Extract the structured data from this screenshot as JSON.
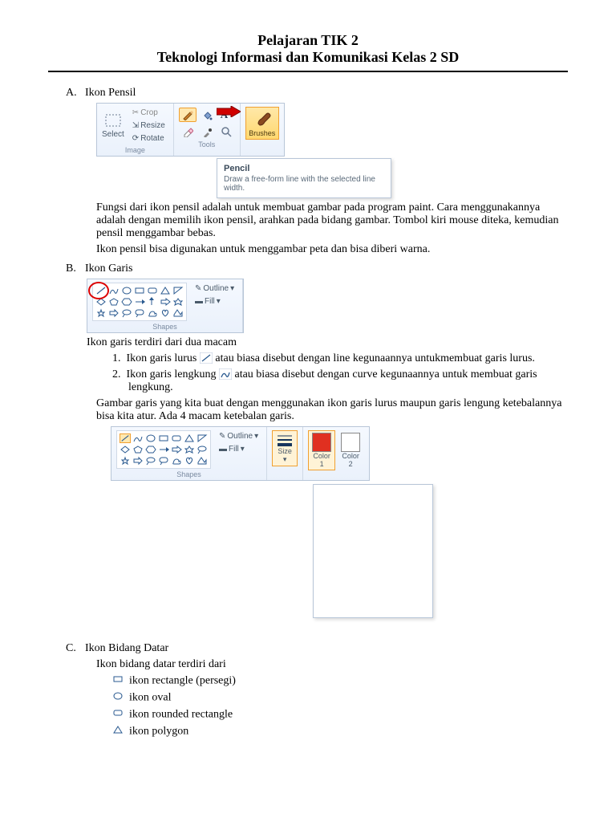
{
  "title": "Pelajaran TIK 2",
  "subtitle": "Teknologi Informasi dan Komunikasi Kelas 2 SD",
  "sections": {
    "A": {
      "letter": "A.",
      "heading": "Ikon Pensil",
      "ribbon": {
        "select": "Select",
        "crop": "Crop",
        "resize": "Resize",
        "rotate": "Rotate",
        "image_group": "Image",
        "tools_group": "Tools",
        "brushes": "Brushes"
      },
      "tooltip_title": "Pencil",
      "tooltip_body": "Draw a free-form line with the selected line width.",
      "para1": "Fungsi dari ikon pensil adalah untuk membuat gambar pada program paint. Cara menggunakannya adalah dengan memilih ikon pensil, arahkan pada bidang gambar. Tombol kiri mouse diteka, kemudian pensil menggambar bebas.",
      "para2": "Ikon pensil bisa digunakan untuk menggambar peta dan bisa diberi warna."
    },
    "B": {
      "letter": "B.",
      "heading": "Ikon Garis",
      "shapes_group": "Shapes",
      "outline": "Outline",
      "fill": "Fill",
      "intro": "Ikon garis terdiri dari dua macam",
      "item1_a": "Ikon garis lurus ",
      "item1_b": " atau biasa disebut dengan line kegunaannya untukmembuat garis lurus.",
      "item2_a": "Ikon garis lengkung ",
      "item2_b": " atau biasa disebut dengan curve kegunaannya untuk membuat garis lengkung.",
      "para": "Gambar garis yang kita buat dengan menggunakan ikon garis lurus maupun garis lengung ketebalannya bisa kita atur. Ada 4 macam ketebalan garis.",
      "size": "Size",
      "color1": "Color\n1",
      "color2": "Color\n2"
    },
    "C": {
      "letter": "C.",
      "heading": "Ikon Bidang Datar",
      "intro": "Ikon bidang datar terdiri dari",
      "items": {
        "rect": "ikon rectangle (persegi)",
        "oval": "ikon oval",
        "rrect": "ikon rounded rectangle",
        "poly": "ikon polygon"
      }
    }
  }
}
